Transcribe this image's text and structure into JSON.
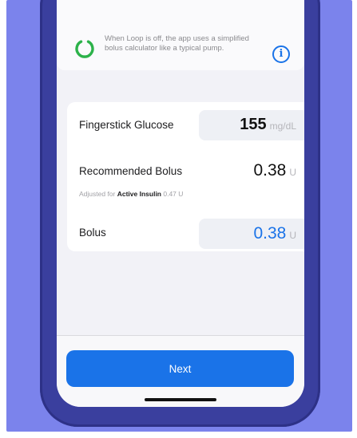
{
  "notice": {
    "icon": "loop-ring-icon",
    "text": "When Loop is off, the app uses a simplified bolus calculator like a typical pump.",
    "info_icon": "info-icon",
    "info_glyph": "i"
  },
  "bolus_form": {
    "fingerstick": {
      "label": "Fingerstick Glucose",
      "value": "155",
      "unit": "mg/dL"
    },
    "recommended": {
      "label": "Recommended Bolus",
      "value": "0.38",
      "unit": "U",
      "adjust_prefix": "Adjusted for ",
      "adjust_emphasis": "Active Insulin",
      "adjust_value": " 0.47 U"
    },
    "bolus": {
      "label": "Bolus",
      "value": "0.38",
      "unit": "U"
    }
  },
  "footer": {
    "next_label": "Next"
  },
  "colors": {
    "background": "#7b83ec",
    "phone_frame": "#3a3f9e",
    "accent": "#1a73e8",
    "loop_ring": "#2cb24a"
  }
}
